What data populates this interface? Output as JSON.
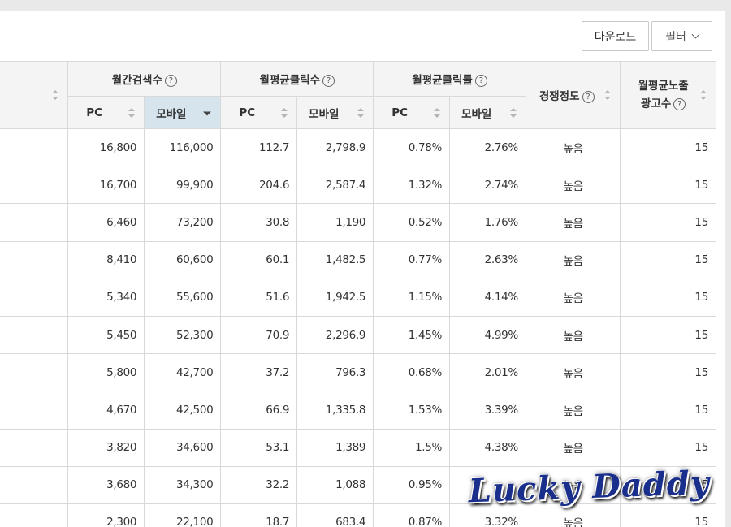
{
  "toolbar": {
    "download_label": "다운로드",
    "filter_label": "필터"
  },
  "headers": {
    "monthly_search": "월간검색수",
    "avg_clicks": "월평균클릭수",
    "avg_ctr": "월평균클릭률",
    "competition": "경쟁정도",
    "ad_count_line1": "월평균노출",
    "ad_count_line2": "광고수",
    "pc": "PC",
    "mobile": "모바일",
    "help": "?"
  },
  "rows": [
    [
      "16,800",
      "116,000",
      "112.7",
      "2,798.9",
      "0.78%",
      "2.76%",
      "높음",
      "15"
    ],
    [
      "16,700",
      "99,900",
      "204.6",
      "2,587.4",
      "1.32%",
      "2.74%",
      "높음",
      "15"
    ],
    [
      "6,460",
      "73,200",
      "30.8",
      "1,190",
      "0.52%",
      "1.76%",
      "높음",
      "15"
    ],
    [
      "8,410",
      "60,600",
      "60.1",
      "1,482.5",
      "0.77%",
      "2.63%",
      "높음",
      "15"
    ],
    [
      "5,340",
      "55,600",
      "51.6",
      "1,942.5",
      "1.15%",
      "4.14%",
      "높음",
      "15"
    ],
    [
      "5,450",
      "52,300",
      "70.9",
      "2,296.9",
      "1.45%",
      "4.99%",
      "높음",
      "15"
    ],
    [
      "5,800",
      "42,700",
      "37.2",
      "796.3",
      "0.68%",
      "2.01%",
      "높음",
      "15"
    ],
    [
      "4,670",
      "42,500",
      "66.9",
      "1,335.8",
      "1.53%",
      "3.39%",
      "높음",
      "15"
    ],
    [
      "3,820",
      "34,600",
      "53.1",
      "1,389",
      "1.5%",
      "4.38%",
      "높음",
      "15"
    ],
    [
      "3,680",
      "34,300",
      "32.2",
      "1,088",
      "0.95%",
      "",
      "높음",
      "15"
    ],
    [
      "2,300",
      "22,100",
      "18.7",
      "683.4",
      "0.87%",
      "3.32%",
      "높음",
      "15"
    ]
  ],
  "watermark": "Lucky Daddy"
}
